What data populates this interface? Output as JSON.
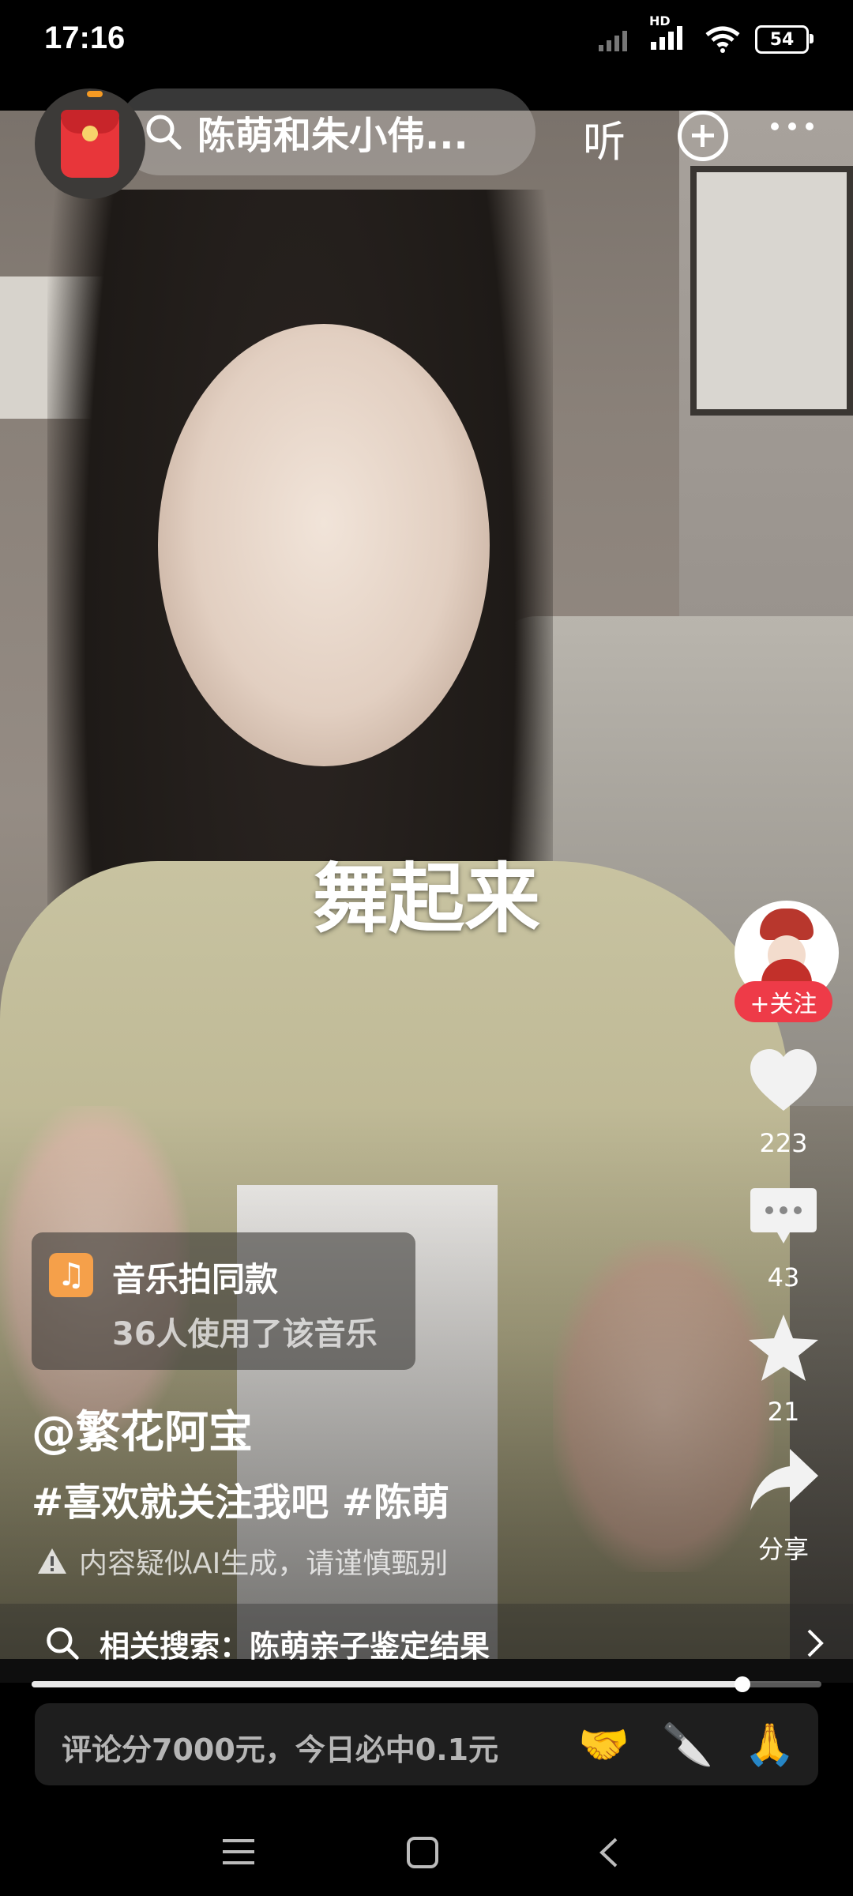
{
  "status_bar": {
    "time": "17:16",
    "network": "HD",
    "battery": "54"
  },
  "top_bar": {
    "search_text": "陈萌和朱小伟...",
    "listen_label": "听"
  },
  "video": {
    "lyric_overlay": "舞起来"
  },
  "right_rail": {
    "follow_label": "+关注",
    "like_count": "223",
    "comment_count": "43",
    "favorite_count": "21",
    "share_label": "分享"
  },
  "music_card": {
    "title": "音乐拍同款",
    "subtitle": "36人使用了该音乐"
  },
  "post": {
    "author": "@繁花阿宝",
    "hashtags": "#喜欢就关注我吧 #陈萌",
    "ai_notice": "内容疑似AI生成，请谨慎甄别"
  },
  "related_search": {
    "text": "相关搜索：陈萌亲子鉴定结果"
  },
  "playback": {
    "progress": 0.9
  },
  "comment_bar": {
    "placeholder": "评论分7000元，今日必中0.1元",
    "emojis": [
      "🤝",
      "🔪",
      "🙏"
    ]
  },
  "colors": {
    "follow_red": "#ee3b48",
    "music_orange": "#f5a04a",
    "redpacket_red": "#e8363a"
  }
}
